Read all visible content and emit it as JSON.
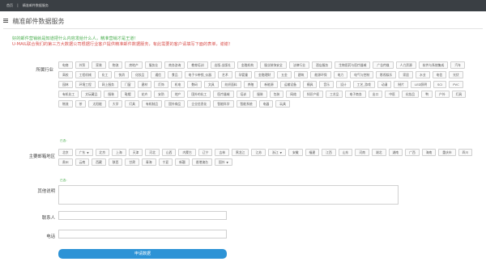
{
  "breadcrumb": [
    "首页",
    "|",
    "精准邮件数据服务"
  ],
  "page_title": "精准邮件数据服务",
  "notice": {
    "line1": "好的邮件营销就是知道把什么内容发给什么人，精准营销才是王道！",
    "line2": "U-MAIL联合我们的第三方大数据公司根据行业客户提供精准邮件数据服务，有此需要的客户请填写下面的表单，谢谢！"
  },
  "industry": {
    "label": "所属行业",
    "tags": [
      "电商",
      "外贸",
      "家装",
      "物流",
      "房地产",
      "服务业",
      "商务咨询",
      "教育培训",
      "出版-出版社",
      "金融机构",
      "服业装饰安全",
      "法律行业",
      "酒店服务",
      "生物医药与医疗器械",
      "广告传媒",
      "人力资源",
      "软件与系统集成",
      "汽车",
      "高校",
      "工程机械",
      "化工",
      "快消",
      "化妆品",
      "通信",
      "食品",
      "电子卡带锁_仪器",
      "艺术",
      "孕婴童",
      "金融理财",
      "五金",
      "建筑",
      "能源环保",
      "电力",
      "电气与控制",
      "影视娱乐",
      "家居",
      "水业",
      "电信",
      "光伏",
      "园林",
      "环境工程",
      "网上服务",
      "门窗",
      "建材",
      "灯饰",
      "机电",
      "数码",
      "文具",
      "纺织面料",
      "养殖",
      "新能源",
      "运输设备",
      "模具",
      "音乐",
      "设计",
      "工艺_游戏",
      "动漫",
      "制片",
      "LED照明",
      "SCI",
      "PVC",
      "有机化工",
      "文玩藏品",
      "服装",
      "鞋帽",
      "花卉",
      "安防",
      "地产",
      "国外的化工",
      "医疗器械",
      "培训",
      "服装",
      "包装",
      "网络",
      "知识产权",
      "工艺品",
      "电子商务",
      "出口",
      "中医",
      "化妆品",
      "鸭",
      "户外",
      "灯具",
      "物流",
      "茶",
      "太阳能",
      "大学",
      "灯具",
      "有机制品",
      "国外商品",
      "企业信息化",
      "智能科学",
      "智能系统",
      "电器",
      "玩具"
    ]
  },
  "region": {
    "label": "主要邮箱地区",
    "tags": [
      "北京",
      "广东",
      "北京",
      "上海",
      "天津",
      "河北",
      "山西",
      "内蒙古",
      "辽宁",
      "吉林",
      "黑龙江",
      "江苏",
      "浙江",
      "安徽",
      "福建",
      "江西",
      "山东",
      "河南",
      "湖北",
      "湖南",
      "广西",
      "海南",
      "重庆市",
      "四川",
      "贵州",
      "云南",
      "西藏",
      "陕西",
      "甘肃",
      "青海",
      "宁夏",
      "新疆",
      "香港澳台",
      "国外"
    ],
    "caret_tags": [
      1,
      12,
      33
    ]
  },
  "hint_text": "已选：",
  "other_label": "其他说明",
  "contact_label": "联系人",
  "phone_label": "电话",
  "submit_label": "申请数据"
}
